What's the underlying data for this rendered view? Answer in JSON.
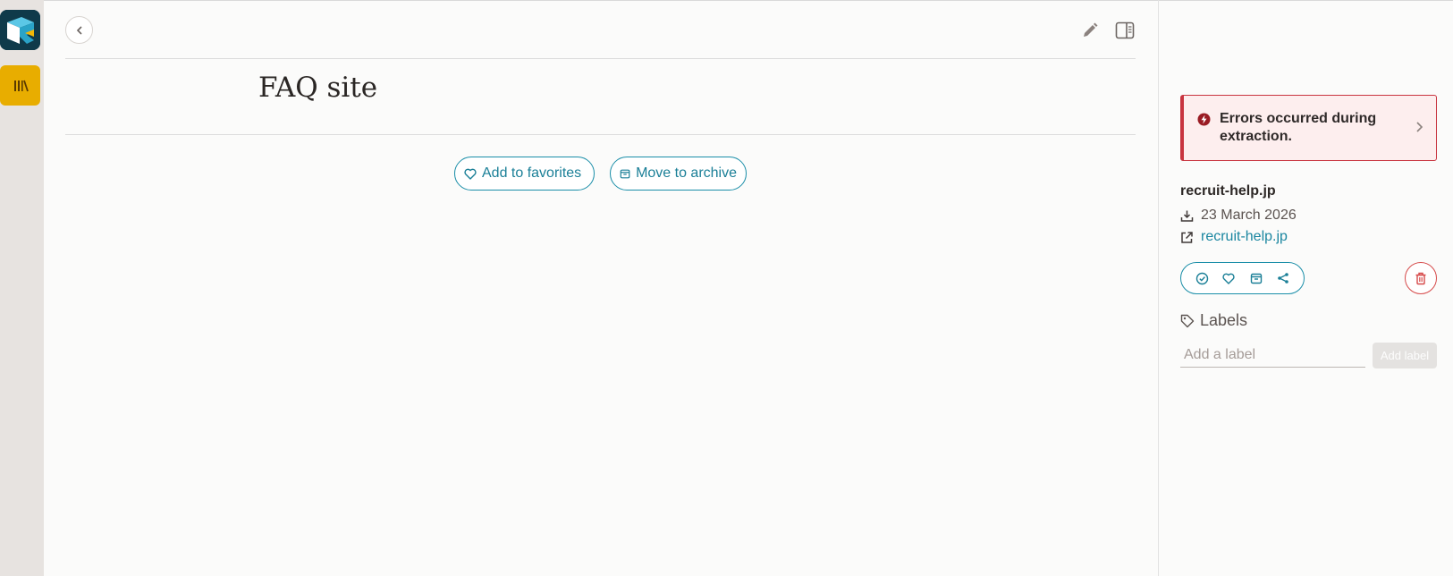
{
  "article": {
    "title": "FAQ site",
    "favorite_label": "Add to favorites",
    "archive_label": "Move to archive"
  },
  "sidebar": {
    "error_message": "Errors occurred during extraction.",
    "site_name": "recruit-help.jp",
    "date": "23 March 2026",
    "link_text": "recruit-help.jp",
    "labels_heading": "Labels",
    "label_placeholder": "Add a label",
    "add_label_button": "Add label"
  },
  "colors": {
    "accent": "#1a8ea8",
    "error": "#c8343f",
    "library": "#e8ad00",
    "logo_bg": "#0f3a4a"
  }
}
